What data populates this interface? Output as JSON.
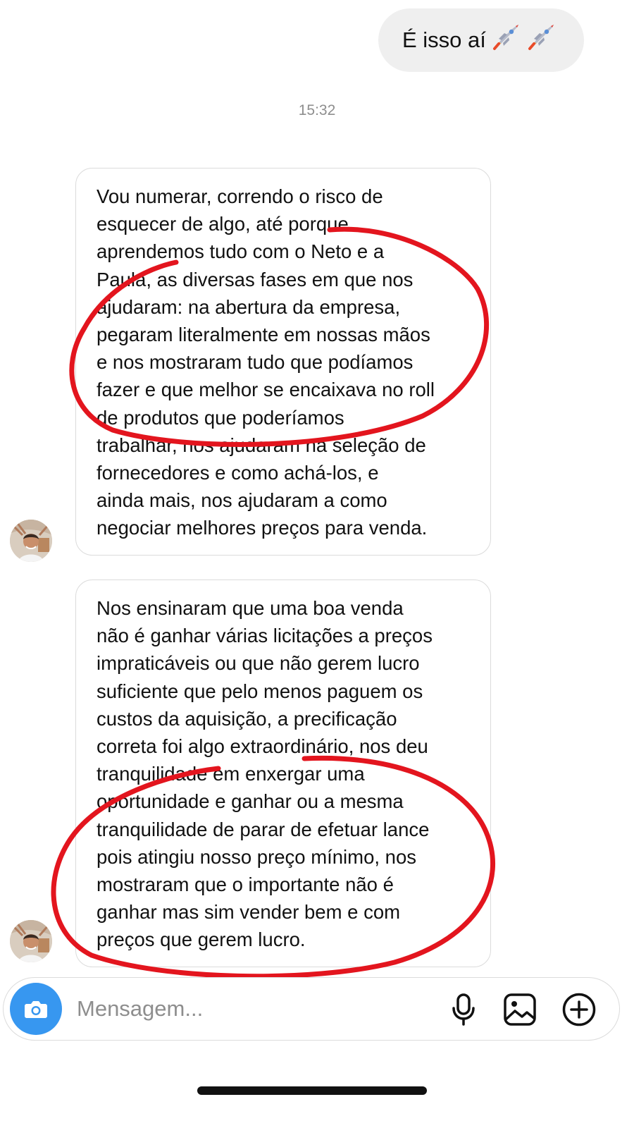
{
  "sent_message": {
    "text": "É isso aí"
  },
  "timestamp": "15:32",
  "received_messages": [
    {
      "lines": [
        "Vou numerar, correndo o risco de",
        "esquecer de algo, até porque",
        "aprendemos tudo com o Neto e a",
        "Paula, as diversas fases em que nos",
        "ajudaram: na abertura da empresa,",
        "pegaram literalmente em nossas mãos",
        "e nos mostraram tudo que podíamos",
        "fazer e que melhor se encaixava no roll",
        "de produtos que poderíamos",
        "trabalhar, nos ajudaram na seleção de",
        "fornecedores e como achá-los, e",
        "ainda mais, nos ajudaram a como",
        "negociar melhores preços para venda."
      ]
    },
    {
      "lines": [
        "Nos ensinaram que uma boa venda",
        "não é ganhar várias licitações a preços",
        "impraticáveis ou que não gerem lucro",
        "suficiente que pelo menos paguem os",
        "custos da aquisição, a precificação",
        "correta foi algo extraordinário, nos deu",
        "tranquilidade em enxergar uma",
        "oportunidade e ganhar ou a mesma",
        "tranquilidade de parar de efetuar lance",
        "pois atingiu nosso preço mínimo, nos",
        "mostraram que o importante não é",
        "ganhar mas sim vender bem e com",
        "preços que gerem lucro."
      ]
    }
  ],
  "composer": {
    "placeholder": "Mensagem..."
  },
  "icons": {
    "sent_emoji": "rocket-icon",
    "camera": "camera-icon",
    "microphone": "microphone-icon",
    "gallery": "image-icon",
    "more": "plus-circle-icon"
  },
  "colors": {
    "accent": "#3797f0",
    "annotation": "#e3151e",
    "sent_bubble": "#efefef",
    "timestamp": "#8e8e8e"
  }
}
